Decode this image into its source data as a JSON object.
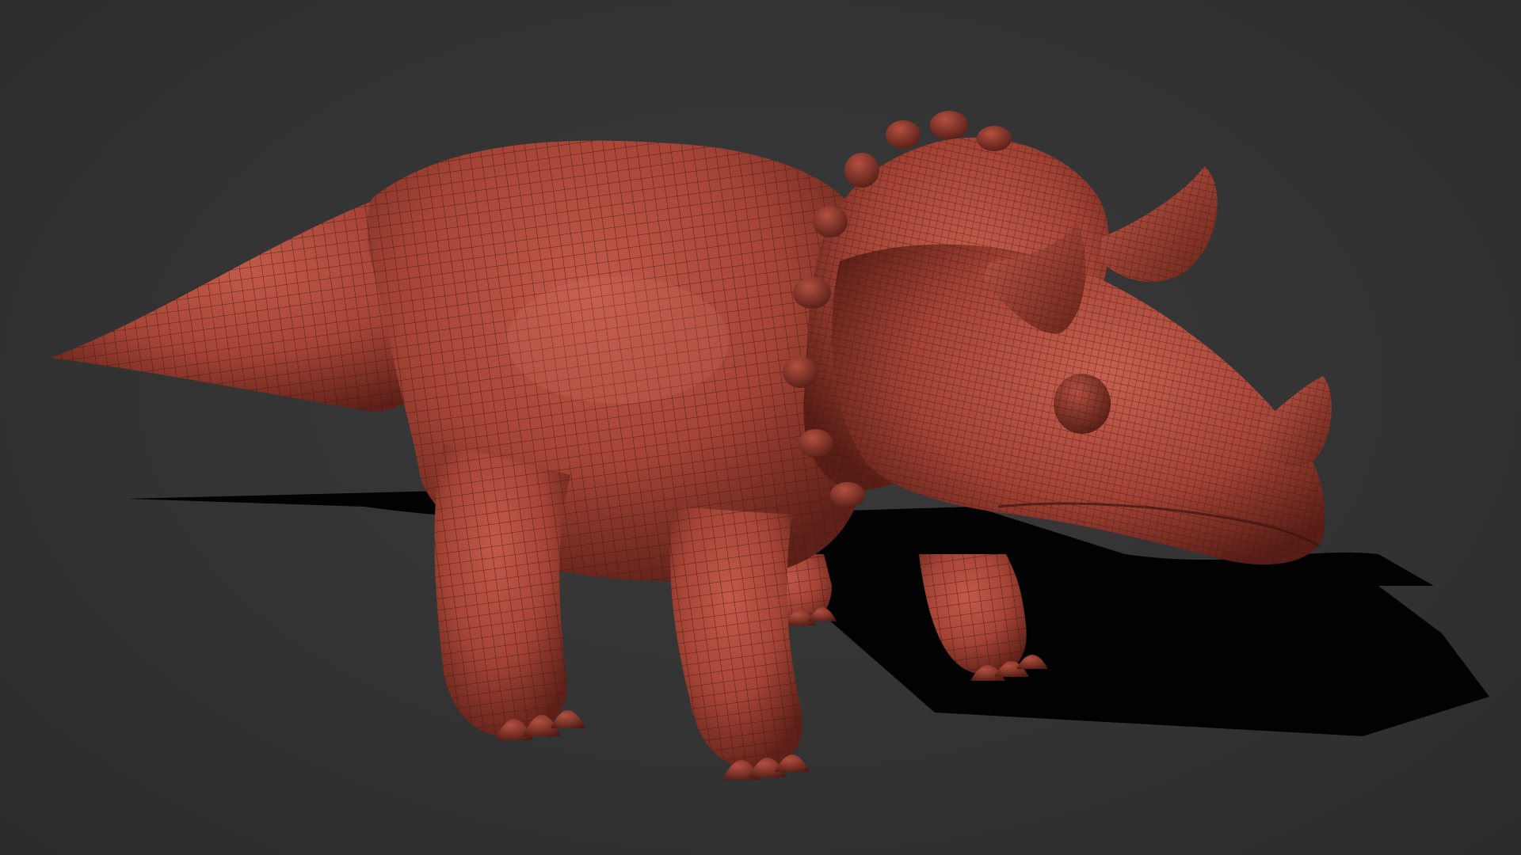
{
  "viewport": {
    "background_color": "#333333"
  },
  "model": {
    "subject": "triceratops",
    "material_color": "#a9473a",
    "wireframe_color": "#3a1410",
    "shadow_color": "#000000"
  }
}
